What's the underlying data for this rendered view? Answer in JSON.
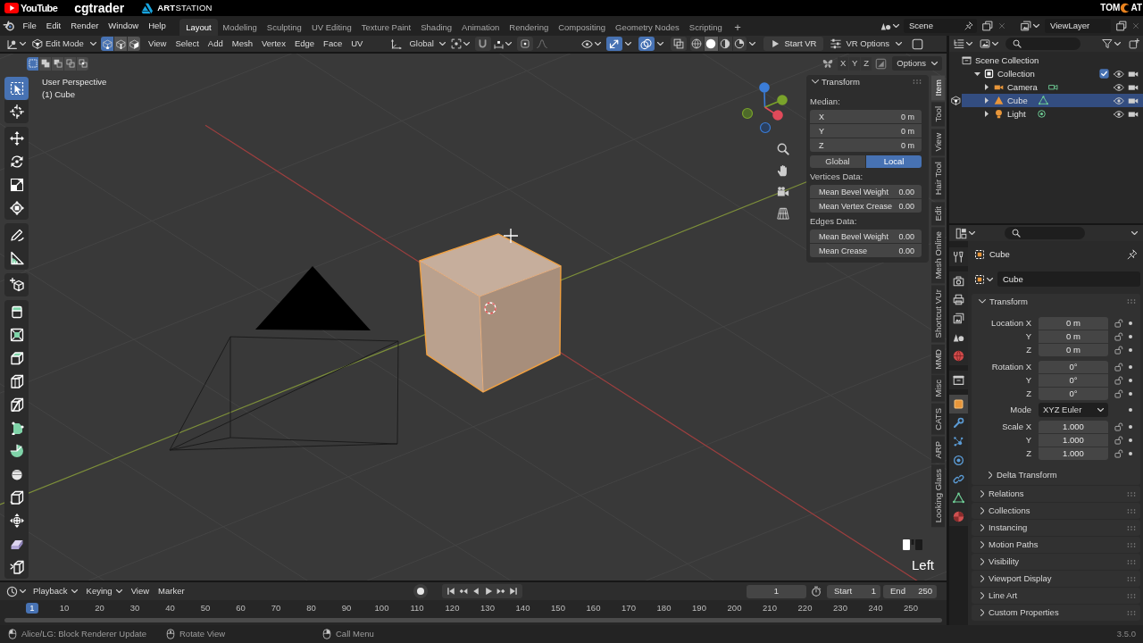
{
  "banner": {
    "logos": [
      {
        "kind": "youtube",
        "text": "YouTube"
      },
      {
        "kind": "cgtrader",
        "text": "cgtrader"
      },
      {
        "kind": "artstation",
        "text": "**ART**STATION"
      }
    ],
    "channel_logo": {
      "left": "TOM",
      "right": "AT"
    }
  },
  "top_bar": {
    "menus": [
      "File",
      "Edit",
      "Render",
      "Window",
      "Help"
    ],
    "workspaces": [
      {
        "label": "Layout",
        "selected": true
      },
      {
        "label": "Modeling",
        "selected": false
      },
      {
        "label": "Sculpting",
        "selected": false
      },
      {
        "label": "UV Editing",
        "selected": false
      },
      {
        "label": "Texture Paint",
        "selected": false
      },
      {
        "label": "Shading",
        "selected": false
      },
      {
        "label": "Animation",
        "selected": false
      },
      {
        "label": "Rendering",
        "selected": false
      },
      {
        "label": "Compositing",
        "selected": false
      },
      {
        "label": "Geometry Nodes",
        "selected": false
      },
      {
        "label": "Scripting",
        "selected": false
      }
    ],
    "add_workspace": "+",
    "scene": "Scene",
    "view_layer": "ViewLayer"
  },
  "viewport": {
    "header": {
      "mode": "Edit Mode",
      "select_modes": [
        {
          "selected": true
        },
        {
          "selected": false
        },
        {
          "selected": false
        }
      ],
      "menus": [
        "View",
        "Select",
        "Add",
        "Mesh",
        "Vertex",
        "Edge",
        "Face",
        "UV"
      ],
      "orientation": "Global",
      "snap_on": false,
      "proportional_on": false,
      "gizmos_on": true,
      "overlays_on": true,
      "xray_on": false,
      "shading_modes": [
        {
          "selected": false
        },
        {
          "selected": true
        },
        {
          "selected": false
        },
        {
          "selected": false
        }
      ],
      "start_vr": "Start VR",
      "vr_options": "VR Options"
    },
    "subheader": {
      "box_modes": [
        {
          "selected": true
        },
        {
          "selected": false
        },
        {
          "selected": false
        },
        {
          "selected": false
        },
        {
          "selected": false
        }
      ],
      "mirror_axes": [
        {
          "label": "X",
          "on": false
        },
        {
          "label": "Y",
          "on": false
        },
        {
          "label": "Z",
          "on": false
        }
      ],
      "options": "Options"
    },
    "toolbar": [
      {
        "tools": [
          {
            "selected": true
          },
          {
            "selected": false
          }
        ]
      },
      {
        "tools": [
          {
            "selected": false
          },
          {
            "selected": false
          },
          {
            "selected": false
          },
          {
            "selected": false
          }
        ]
      },
      {
        "tools": [
          {
            "selected": false
          },
          {
            "selected": false
          }
        ]
      },
      {
        "tools": [
          {
            "selected": false
          }
        ]
      },
      {
        "tools": [
          {
            "selected": false
          },
          {
            "selected": false
          },
          {
            "selected": false
          },
          {
            "selected": false
          },
          {
            "selected": false
          },
          {
            "selected": false
          },
          {
            "selected": false
          },
          {
            "selected": false
          },
          {
            "selected": false
          },
          {
            "selected": false
          },
          {
            "selected": false
          },
          {
            "selected": false
          }
        ]
      }
    ],
    "view_name": "User Perspective",
    "object_label": "(1) Cube",
    "key_overlay": "Left"
  },
  "sidebar": {
    "panel": {
      "title": "Transform",
      "expanded": true
    },
    "median_label": "Median:",
    "median": [
      {
        "label": "X",
        "value": "0 m"
      },
      {
        "label": "Y",
        "value": "0 m"
      },
      {
        "label": "Z",
        "value": "0 m"
      }
    ],
    "space": [
      {
        "label": "Global",
        "selected": false
      },
      {
        "label": "Local",
        "selected": true
      }
    ],
    "groups": [
      {
        "title": "Vertices Data:",
        "fields": [
          {
            "label": "Mean Bevel Weight",
            "value": "0.00"
          },
          {
            "label": "Mean Vertex Crease",
            "value": "0.00"
          }
        ]
      },
      {
        "title": "Edges Data:",
        "fields": [
          {
            "label": "Mean Bevel Weight",
            "value": "0.00"
          },
          {
            "label": "Mean Crease",
            "value": "0.00"
          }
        ]
      }
    ],
    "tabs": [
      {
        "label": "Item",
        "selected": true
      },
      {
        "label": "Tool",
        "selected": false
      },
      {
        "label": "View",
        "selected": false
      },
      {
        "label": "Hair Tool",
        "selected": false
      },
      {
        "label": "Edit",
        "selected": false
      },
      {
        "label": "Mesh Online",
        "selected": false
      },
      {
        "label": "Shortcut VUr",
        "selected": false
      },
      {
        "label": "MMD",
        "selected": false
      },
      {
        "label": "Misc",
        "selected": false
      },
      {
        "label": "CATS",
        "selected": false
      },
      {
        "label": "ARP",
        "selected": false
      },
      {
        "label": "Looking Glass",
        "selected": false
      }
    ]
  },
  "outliner": {
    "tree": [
      {
        "name": "Scene Collection",
        "kind": "scene_collection",
        "selected": false,
        "children": [
          {
            "name": "Collection",
            "kind": "collection",
            "expanded": true,
            "checked": true,
            "selected": false,
            "children": [
              {
                "name": "Camera",
                "kind": "camera",
                "expanded": false,
                "selected": false,
                "edit_mode": false
              },
              {
                "name": "Cube",
                "kind": "mesh",
                "expanded": false,
                "selected": true,
                "edit_mode": true
              },
              {
                "name": "Light",
                "kind": "light",
                "expanded": false,
                "selected": false,
                "edit_mode": false
              }
            ]
          }
        ]
      }
    ]
  },
  "properties": {
    "tab_groups": [
      {
        "tabs": [
          {
            "selected": false
          }
        ]
      },
      {
        "tabs": [
          {
            "selected": false
          },
          {
            "selected": false
          },
          {
            "selected": false
          },
          {
            "selected": false
          },
          {
            "selected": false
          }
        ]
      },
      {
        "tabs": [
          {
            "selected": false
          }
        ]
      },
      {
        "tabs": [
          {
            "selected": true
          },
          {
            "selected": false
          },
          {
            "selected": false
          },
          {
            "selected": false
          },
          {
            "selected": false
          },
          {
            "selected": false
          },
          {
            "selected": false
          }
        ]
      }
    ],
    "object_name": "Cube",
    "name_field": "Cube",
    "transform": {
      "title": "Transform",
      "expanded": true,
      "groups": [
        {
          "kind": "vector",
          "rows": [
            {
              "label": "Location X",
              "value": "0 m",
              "locked": false
            },
            {
              "label": "Y",
              "value": "0 m",
              "locked": false
            },
            {
              "label": "Z",
              "value": "0 m",
              "locked": false
            }
          ]
        },
        {
          "kind": "vector",
          "rows": [
            {
              "label": "Rotation X",
              "value": "0°",
              "locked": false
            },
            {
              "label": "Y",
              "value": "0°",
              "locked": false
            },
            {
              "label": "Z",
              "value": "0°",
              "locked": false
            }
          ]
        },
        {
          "kind": "dropdown",
          "label": "Mode",
          "value": "XYZ Euler"
        },
        {
          "kind": "vector",
          "rows": [
            {
              "label": "Scale X",
              "value": "1.000",
              "locked": false
            },
            {
              "label": "Y",
              "value": "1.000",
              "locked": false
            },
            {
              "label": "Z",
              "value": "1.000",
              "locked": false
            }
          ]
        }
      ],
      "subpanels": [
        {
          "title": "Delta Transform",
          "expanded": false
        }
      ]
    },
    "panels": [
      {
        "title": "Relations",
        "expanded": false
      },
      {
        "title": "Collections",
        "expanded": false
      },
      {
        "title": "Instancing",
        "expanded": false
      },
      {
        "title": "Motion Paths",
        "expanded": false
      },
      {
        "title": "Visibility",
        "expanded": false
      },
      {
        "title": "Viewport Display",
        "expanded": false
      },
      {
        "title": "Line Art",
        "expanded": false
      },
      {
        "title": "Custom Properties",
        "expanded": false
      }
    ]
  },
  "timeline": {
    "menus": [
      {
        "label": "Playback",
        "kind": "dropdown"
      },
      {
        "label": "Keying",
        "kind": "dropdown"
      },
      {
        "label": "View",
        "kind": "menu"
      },
      {
        "label": "Marker",
        "kind": "menu"
      }
    ],
    "current_frame": "1",
    "start": {
      "label": "Start",
      "value": "1"
    },
    "end": {
      "label": "End",
      "value": "250"
    },
    "ruler": [
      {
        "label": "1",
        "selected": true
      },
      {
        "label": "10",
        "selected": false
      },
      {
        "label": "20",
        "selected": false
      },
      {
        "label": "30",
        "selected": false
      },
      {
        "label": "40",
        "selected": false
      },
      {
        "label": "50",
        "selected": false
      },
      {
        "label": "60",
        "selected": false
      },
      {
        "label": "70",
        "selected": false
      },
      {
        "label": "80",
        "selected": false
      },
      {
        "label": "90",
        "selected": false
      },
      {
        "label": "100",
        "selected": false
      },
      {
        "label": "110",
        "selected": false
      },
      {
        "label": "120",
        "selected": false
      },
      {
        "label": "130",
        "selected": false
      },
      {
        "label": "140",
        "selected": false
      },
      {
        "label": "150",
        "selected": false
      },
      {
        "label": "160",
        "selected": false
      },
      {
        "label": "170",
        "selected": false
      },
      {
        "label": "180",
        "selected": false
      },
      {
        "label": "190",
        "selected": false
      },
      {
        "label": "200",
        "selected": false
      },
      {
        "label": "210",
        "selected": false
      },
      {
        "label": "220",
        "selected": false
      },
      {
        "label": "230",
        "selected": false
      },
      {
        "label": "240",
        "selected": false
      },
      {
        "label": "250",
        "selected": false
      }
    ]
  },
  "status_bar": {
    "hints": [
      {
        "kind": "left",
        "text": "Alice/LG: Block Renderer Update"
      },
      {
        "kind": "middle",
        "text": "Rotate View"
      },
      {
        "kind": "right",
        "text": "Call Menu"
      }
    ],
    "version": "3.5.0"
  }
}
